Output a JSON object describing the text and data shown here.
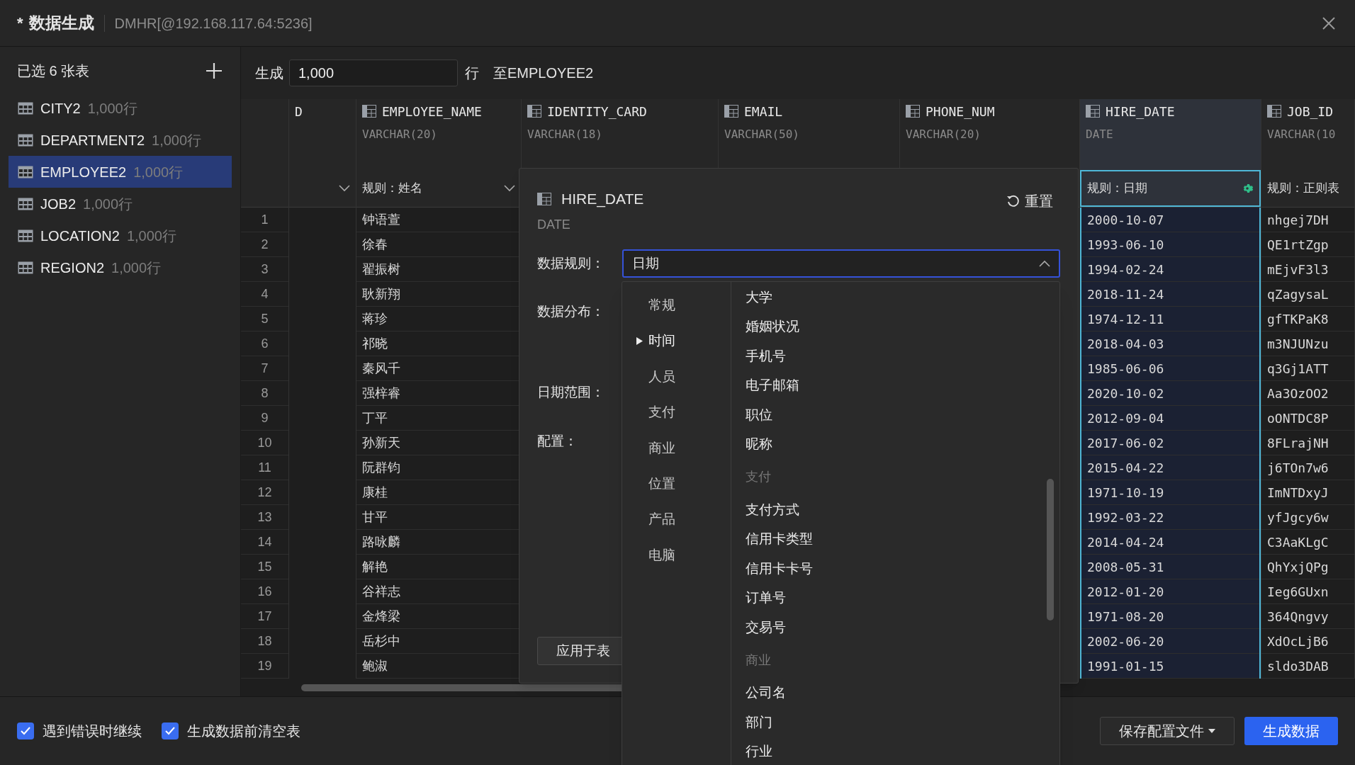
{
  "window": {
    "modified_mark": "*",
    "title": "数据生成",
    "connection": "DMHR[@192.168.117.64:5236]"
  },
  "sidebar": {
    "heading": "已选 6 张表",
    "tables": [
      {
        "name": "CITY2",
        "rows": "1,000行",
        "selected": false
      },
      {
        "name": "DEPARTMENT2",
        "rows": "1,000行",
        "selected": false
      },
      {
        "name": "EMPLOYEE2",
        "rows": "1,000行",
        "selected": true
      },
      {
        "name": "JOB2",
        "rows": "1,000行",
        "selected": false
      },
      {
        "name": "LOCATION2",
        "rows": "1,000行",
        "selected": false
      },
      {
        "name": "REGION2",
        "rows": "1,000行",
        "selected": false
      }
    ]
  },
  "toolbar": {
    "label": "生成",
    "value": "1,000",
    "unit": "行",
    "target": "至EMPLOYEE2"
  },
  "table": {
    "row_numbers": [
      "1",
      "2",
      "3",
      "4",
      "5",
      "6",
      "7",
      "8",
      "9",
      "10",
      "11",
      "12",
      "13",
      "14",
      "15",
      "16",
      "17",
      "18",
      "19"
    ],
    "columns": [
      {
        "name": "D",
        "selected": false,
        "rule_menu": true
      },
      {
        "name": "EMPLOYEE_NAME",
        "type": "VARCHAR(20)",
        "rule": "规则：姓名",
        "selected": false,
        "rule_menu": true,
        "values": [
          "钟语萱",
          "徐春",
          "翟振树",
          "耿新翔",
          "蒋珍",
          "祁晓",
          "秦风千",
          "强梓睿",
          "丁平",
          "孙新天",
          "阮群钧",
          "康桂",
          "甘平",
          "路咏麟",
          "解艳",
          "谷祥志",
          "金烽梁",
          "岳杉中",
          "鲍淑"
        ]
      },
      {
        "name": "IDENTITY_CARD",
        "type": "VARCHAR(18)",
        "selected": false
      },
      {
        "name": "EMAIL",
        "type": "VARCHAR(50)",
        "selected": false
      },
      {
        "name": "PHONE_NUM",
        "type": "VARCHAR(20)",
        "selected": false
      },
      {
        "name": "HIRE_DATE",
        "type": "DATE",
        "rule": "规则：日期",
        "selected": true,
        "rule_menu": false,
        "values": [
          "2000-10-07",
          "1993-06-10",
          "1994-02-24",
          "2018-11-24",
          "1974-12-11",
          "2018-04-03",
          "1985-06-06",
          "2020-10-02",
          "2012-09-04",
          "2017-06-02",
          "2015-04-22",
          "1971-10-19",
          "1992-03-22",
          "2014-04-24",
          "2008-05-31",
          "2012-01-20",
          "1971-08-20",
          "2002-06-20",
          "1991-01-15"
        ]
      },
      {
        "name": "JOB_ID",
        "type": "VARCHAR(10",
        "rule": "规则：正则表",
        "selected": false,
        "rule_menu": false,
        "values": [
          "nhgej7DH",
          "QE1rtZgp",
          "mEjvF3l3",
          "qZagysaL",
          "gfTKPaK8",
          "m3NJUNzu",
          "q3Gj1ATT",
          "Aa3OzOO2",
          "oONTDC8P",
          "8FLrajNH",
          "j6TOn7w6",
          "ImNTDxyJ",
          "yfJgcy6w",
          "C3AaKLgC",
          "QhYxjQPg",
          "Ieg6GUxn",
          "364Qngvy",
          "XdOcLjB6",
          "sldo3DAB"
        ]
      }
    ]
  },
  "editor": {
    "title": "HIRE_DATE",
    "type": "DATE",
    "reset": "重置",
    "rule_label": "数据规则：",
    "rule_value": "日期",
    "distribution_label": "数据分布：",
    "range_label": "日期范围：",
    "config_label": "配置：",
    "apply_button": "应用于表"
  },
  "dropdown": {
    "categories": [
      {
        "label": "常规",
        "selected": false
      },
      {
        "label": "时间",
        "selected": true
      },
      {
        "label": "人员",
        "selected": false
      },
      {
        "label": "支付",
        "selected": false
      },
      {
        "label": "商业",
        "selected": false
      },
      {
        "label": "位置",
        "selected": false
      },
      {
        "label": "产品",
        "selected": false
      },
      {
        "label": "电脑",
        "selected": false
      }
    ],
    "options": [
      {
        "kind": "item",
        "label": "大学"
      },
      {
        "kind": "item",
        "label": "婚姻状况"
      },
      {
        "kind": "item",
        "label": "手机号"
      },
      {
        "kind": "item",
        "label": "电子邮箱"
      },
      {
        "kind": "item",
        "label": "职位"
      },
      {
        "kind": "item",
        "label": "昵称"
      },
      {
        "kind": "header",
        "label": "支付"
      },
      {
        "kind": "item",
        "label": "支付方式"
      },
      {
        "kind": "item",
        "label": "信用卡类型"
      },
      {
        "kind": "item",
        "label": "信用卡卡号"
      },
      {
        "kind": "item",
        "label": "订单号"
      },
      {
        "kind": "item",
        "label": "交易号"
      },
      {
        "kind": "header",
        "label": "商业"
      },
      {
        "kind": "item",
        "label": "公司名"
      },
      {
        "kind": "item",
        "label": "部门"
      },
      {
        "kind": "item",
        "label": "行业"
      }
    ]
  },
  "footer": {
    "options": [
      {
        "label": "遇到错误时继续",
        "checked": true
      },
      {
        "label": "生成数据前清空表",
        "checked": true
      }
    ],
    "save_button": "保存配置文件",
    "generate_button": "生成数据"
  }
}
